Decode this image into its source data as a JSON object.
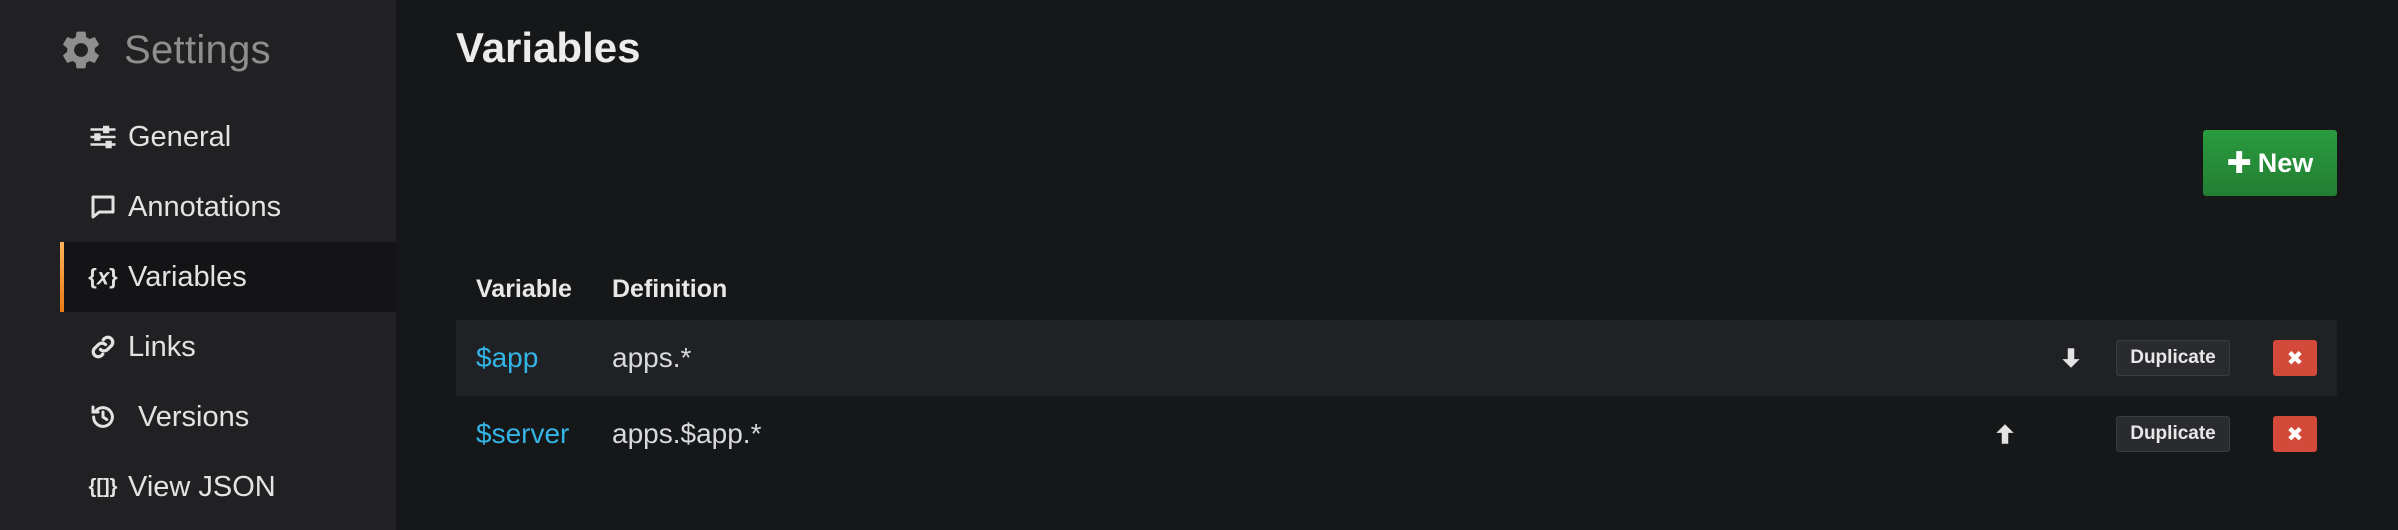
{
  "sidebar": {
    "title": "Settings",
    "items": [
      {
        "label": "General",
        "icon": "sliders-icon"
      },
      {
        "label": "Annotations",
        "icon": "comment-icon"
      },
      {
        "label": "Variables",
        "icon": "variable-icon",
        "glyph": "{𝑥}",
        "active": true
      },
      {
        "label": "Links",
        "icon": "link-icon"
      },
      {
        "label": "Versions",
        "icon": "history-icon"
      },
      {
        "label": "View JSON",
        "icon": "json-icon",
        "glyph": "{[]}"
      }
    ]
  },
  "main": {
    "title": "Variables",
    "new_button": {
      "label": "New",
      "color": "#299c3f"
    },
    "table": {
      "headers": {
        "variable": "Variable",
        "definition": "Definition"
      },
      "rows": [
        {
          "name": "$app",
          "definition": "apps.*",
          "move": "down",
          "duplicate": "Duplicate",
          "delete_glyph": "✖"
        },
        {
          "name": "$server",
          "definition": "apps.$app.*",
          "move": "up",
          "duplicate": "Duplicate",
          "delete_glyph": "✖"
        }
      ]
    }
  },
  "colors": {
    "accent": "#eb7b18",
    "link": "#33b5e5",
    "danger": "#d44a3a",
    "success": "#299c3f"
  }
}
